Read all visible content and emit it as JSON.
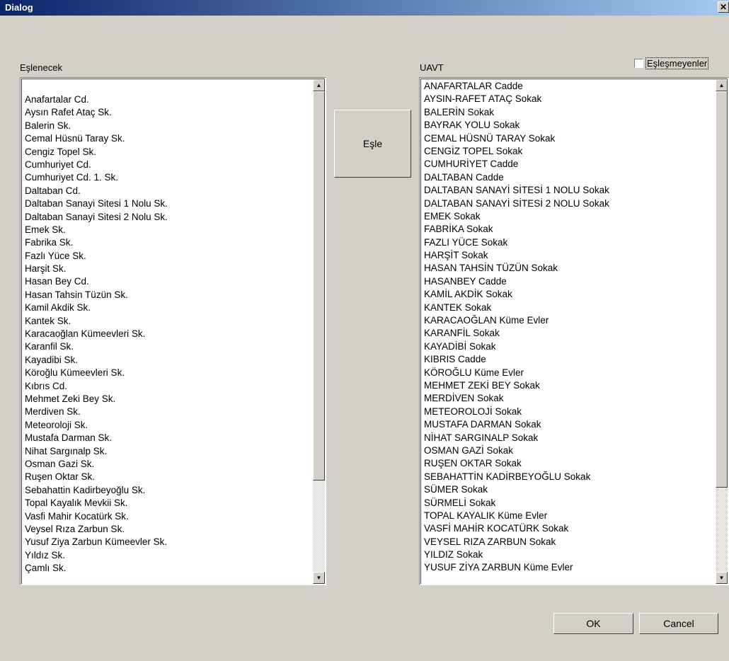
{
  "window": {
    "title": "Dialog",
    "close_glyph": "✕"
  },
  "left_panel": {
    "label": "Eşlenecek",
    "items": [
      "Anafartalar Cd.",
      "Aysın Rafet Ataç Sk.",
      "Balerin Sk.",
      "Cemal Hüsnü Taray Sk.",
      "Cengiz Topel Sk.",
      "Cumhuriyet Cd.",
      "Cumhuriyet Cd. 1. Sk.",
      "Daltaban Cd.",
      "Daltaban Sanayi Sitesi 1 Nolu Sk.",
      "Daltaban Sanayi Sitesi 2 Nolu Sk.",
      "Emek Sk.",
      "Fabrika Sk.",
      "Fazlı Yüce Sk.",
      "Harşit Sk.",
      "Hasan Bey Cd.",
      "Hasan Tahsin Tüzün Sk.",
      "Kamil Akdik Sk.",
      "Kantek Sk.",
      "Karacaoğlan Kümeevleri Sk.",
      "Karanfil Sk.",
      "Kayadibi Sk.",
      "Köroğlu Kümeevleri Sk.",
      "Kıbrıs Cd.",
      "Mehmet Zeki Bey Sk.",
      "Merdiven Sk.",
      "Meteoroloji Sk.",
      "Mustafa Darman Sk.",
      "Nihat Sargınalp Sk.",
      "Osman Gazi Sk.",
      "Ruşen Oktar Sk.",
      "Sebahattin Kadirbeyoğlu Sk.",
      "Topal Kayalık Mevkii Sk.",
      "Vasfi Mahir Kocatürk Sk.",
      "Veysel Rıza Zarbun Sk.",
      "Yusuf Ziya Zarbun Kümeevler Sk.",
      "Yıldız Sk.",
      "Çamlı Sk."
    ]
  },
  "match_button": {
    "label": "Eşle"
  },
  "right_panel": {
    "label": "UAVT",
    "unmatched_checkbox": {
      "label": "Eşleşmeyenler",
      "checked": false
    },
    "items": [
      "ANAFARTALAR Cadde",
      "AYSIN-RAFET ATAÇ Sokak",
      "BALERİN Sokak",
      "BAYRAK YOLU Sokak",
      "CEMAL HÜSNÜ TARAY Sokak",
      "CENGİZ TOPEL Sokak",
      "CUMHURİYET Cadde",
      "DALTABAN Cadde",
      "DALTABAN SANAYİ SİTESİ 1 NOLU Sokak",
      "DALTABAN SANAYİ SİTESİ 2 NOLU Sokak",
      "EMEK Sokak",
      "FABRİKA Sokak",
      "FAZLI YÜCE Sokak",
      "HARŞİT Sokak",
      "HASAN TAHSİN TÜZÜN Sokak",
      "HASANBEY Cadde",
      "KAMİL AKDİK Sokak",
      "KANTEK Sokak",
      "KARACAOĞLAN Küme Evler",
      "KARANFİL Sokak",
      "KAYADİBİ Sokak",
      "KIBRIS Cadde",
      "KÖROĞLU Küme Evler",
      "MEHMET ZEKİ BEY Sokak",
      "MERDİVEN Sokak",
      "METEOROLOJİ Sokak",
      "MUSTAFA DARMAN Sokak",
      "NİHAT SARGINALP Sokak",
      "OSMAN GAZİ Sokak",
      "RUŞEN OKTAR Sokak",
      "SEBAHATTİN KADİRBEYOĞLU Sokak",
      "SÜMER Sokak",
      "SÜRMELİ Sokak",
      "TOPAL KAYALIK Küme Evler",
      "VASFİ MAHİR KOCATÜRK Sokak",
      "VEYSEL RIZA ZARBUN Sokak",
      "YILDIZ Sokak",
      "YUSUF ZİYA ZARBUN Küme Evler"
    ]
  },
  "footer": {
    "ok_label": "OK",
    "cancel_label": "Cancel"
  },
  "icons": {
    "scroll_up": "▲",
    "scroll_down": "▼"
  }
}
